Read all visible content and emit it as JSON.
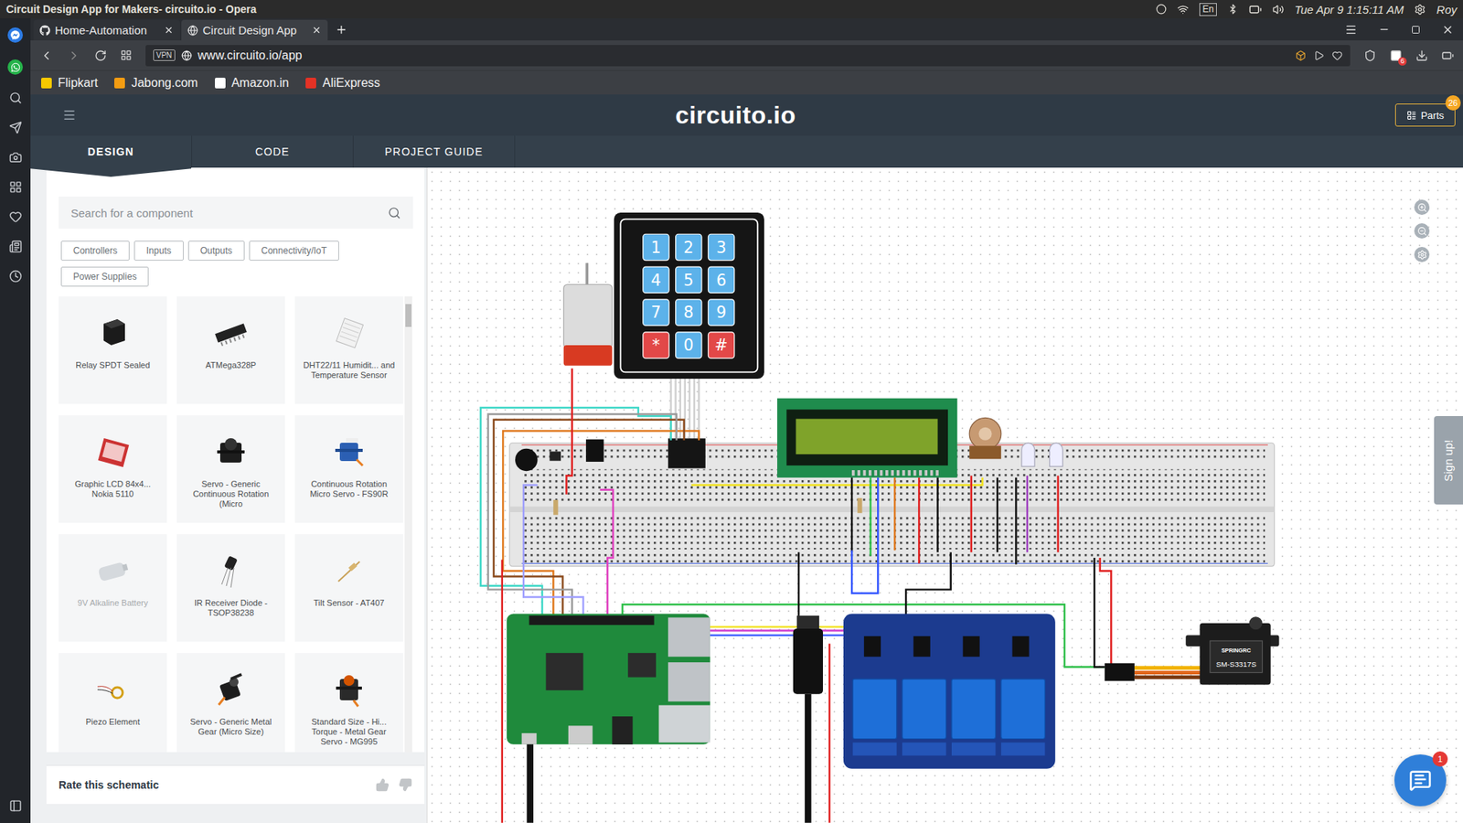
{
  "os_bar": {
    "title": "Circuit Design App for Makers- circuito.io - Opera",
    "keyboard": "En",
    "clock": "Tue Apr 9 1:15:11 AM",
    "user": "Roy"
  },
  "browser": {
    "tabs": [
      {
        "label": "Home-Automation",
        "kind": "github",
        "selected": false
      },
      {
        "label": "Circuit Design App",
        "kind": "site",
        "selected": true
      }
    ],
    "vpn": "VPN",
    "address": "www.circuito.io/app",
    "extension_badge": "6",
    "bookmarks": [
      {
        "label": "Flipkart",
        "color": "#f7c900"
      },
      {
        "label": "Jabong.com",
        "color": "#f39c12"
      },
      {
        "label": "Amazon.in",
        "color": "#ffffff"
      },
      {
        "label": "AliExpress",
        "color": "#e43225"
      }
    ]
  },
  "app": {
    "logo": "circuito.io",
    "parts_button": {
      "label": "Parts",
      "badge": "26"
    },
    "nav": [
      {
        "label": "DESIGN",
        "selected": true
      },
      {
        "label": "CODE",
        "selected": false
      },
      {
        "label": "PROJECT GUIDE",
        "selected": false
      }
    ]
  },
  "sidebar": {
    "search": {
      "placeholder": "Search for a component"
    },
    "filters": [
      "Controllers",
      "Inputs",
      "Outputs",
      "Connectivity/IoT",
      "Power Supplies"
    ],
    "components": [
      {
        "name": "Relay SPDT Sealed",
        "kind": "relay",
        "disabled": false
      },
      {
        "name": "ATMega328P",
        "kind": "chip",
        "disabled": false
      },
      {
        "name": "DHT22/11 Humidit... and Temperature Sensor",
        "kind": "dht",
        "disabled": false
      },
      {
        "name": "Graphic LCD 84x4... Nokia 5110",
        "kind": "lcd",
        "disabled": false
      },
      {
        "name": "Servo - Generic Continuous Rotation (Micro",
        "kind": "servo-black",
        "disabled": false
      },
      {
        "name": "Continuous Rotation Micro Servo - FS90R",
        "kind": "servo-blue",
        "disabled": false
      },
      {
        "name": "9V Alkaline Battery",
        "kind": "battery",
        "disabled": true
      },
      {
        "name": "IR Receiver Diode - TSOP38238",
        "kind": "ir",
        "disabled": false
      },
      {
        "name": "Tilt Sensor - AT407",
        "kind": "tilt",
        "disabled": false
      },
      {
        "name": "Piezo Element",
        "kind": "piezo",
        "disabled": false
      },
      {
        "name": "Servo - Generic Metal Gear (Micro Size)",
        "kind": "servo-arm",
        "disabled": false
      },
      {
        "name": "Standard Size - Hi... Torque - Metal Gear Servo - MG995",
        "kind": "servo-big",
        "disabled": false
      }
    ],
    "rate": "Rate this schematic"
  },
  "canvas": {
    "keypad": [
      {
        "label": "1",
        "kind": "digit"
      },
      {
        "label": "2",
        "kind": "digit"
      },
      {
        "label": "3",
        "kind": "digit"
      },
      {
        "label": "4",
        "kind": "digit"
      },
      {
        "label": "5",
        "kind": "digit"
      },
      {
        "label": "6",
        "kind": "digit"
      },
      {
        "label": "7",
        "kind": "digit"
      },
      {
        "label": "8",
        "kind": "digit"
      },
      {
        "label": "9",
        "kind": "digit"
      },
      {
        "label": "*",
        "kind": "symbol"
      },
      {
        "label": "0",
        "kind": "digit"
      },
      {
        "label": "#",
        "kind": "symbol"
      }
    ],
    "servo": {
      "brand": "SPRINGRC",
      "model": "SM-S3317S"
    },
    "sign_up": "Sign up!",
    "chat_badge": "1"
  }
}
